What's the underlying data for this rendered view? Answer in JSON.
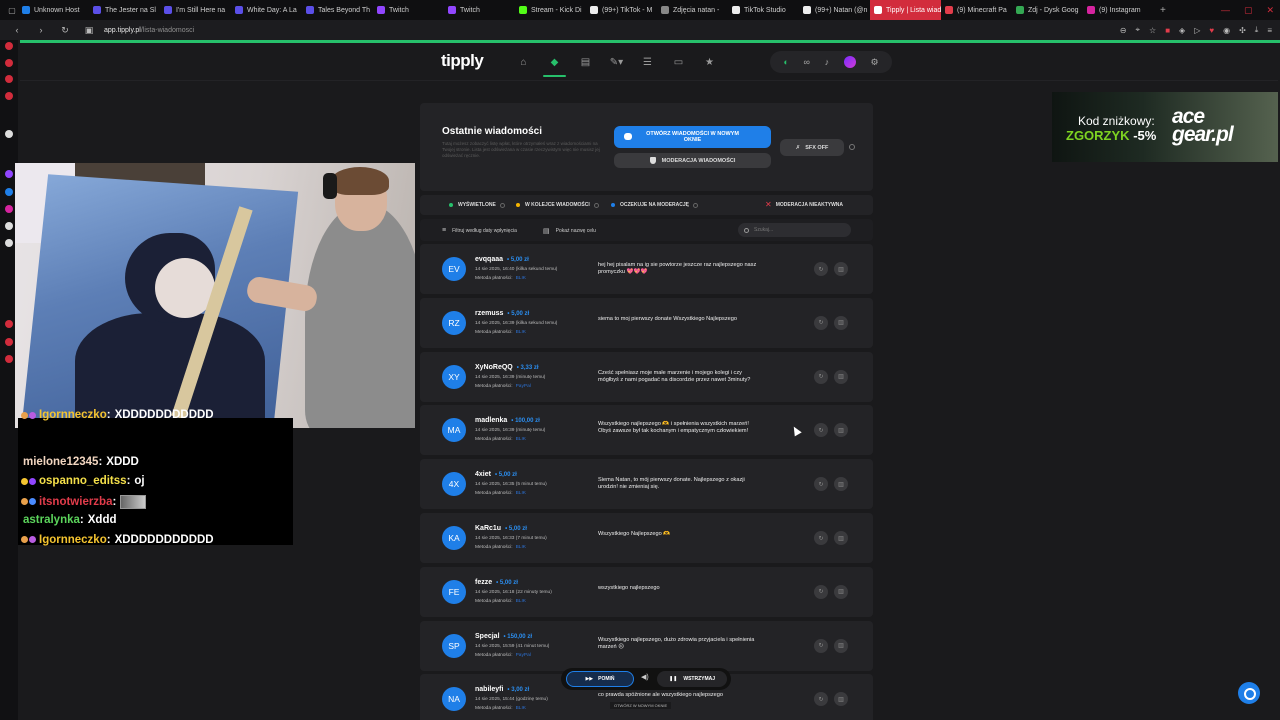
{
  "browser": {
    "tabs": [
      {
        "label": "Unknown Host",
        "color": "#1f7fe8",
        "active": false
      },
      {
        "label": "The Jester na Sl",
        "color": "#5b4fe8",
        "active": false
      },
      {
        "label": "I'm Still Here na",
        "color": "#5b4fe8",
        "active": false
      },
      {
        "label": "White Day: A La",
        "color": "#5b4fe8",
        "active": false
      },
      {
        "label": "Tales Beyond Th",
        "color": "#5b4fe8",
        "active": false
      },
      {
        "label": "Twitch",
        "color": "#9146ff",
        "active": false
      },
      {
        "label": "Twitch",
        "color": "#9146ff",
        "active": false
      },
      {
        "label": "Stream - Kick Di",
        "color": "#53fc18",
        "active": false
      },
      {
        "label": "(99+) TikTok - M",
        "color": "#eee",
        "active": false
      },
      {
        "label": "Zdjęcia natan -",
        "color": "#888",
        "active": false
      },
      {
        "label": "TikTok Studio",
        "color": "#eee",
        "active": false
      },
      {
        "label": "(99+) Natan (@n",
        "color": "#eee",
        "active": false
      },
      {
        "label": "Tipply | Lista wiadomości",
        "color": "#fff",
        "active": true
      },
      {
        "label": "(9) Minecraft Pa",
        "color": "#e23c4b",
        "active": false
      },
      {
        "label": "Zdj - Dysk Goog",
        "color": "#34a853",
        "active": false
      },
      {
        "label": "(9) Instagram",
        "color": "#d6249f",
        "active": false
      }
    ],
    "url_host": "app.tipply.pl",
    "url_path": "/lista-wiadomosci",
    "accent": "#27c06b"
  },
  "header": {
    "logo": "tipply"
  },
  "panel": {
    "title": "Ostatnie wiadomości",
    "description": "Tutaj możesz zobaczyć listę wpłat, które otrzymałeś wraz z wiadomościami na Twojej stronie. Lista jest odświeżana w czasie rzeczywistym więc nie musisz jej odświeżać ręcznie.",
    "open_button": "OTWÓRZ WIADOMOŚCI W NOWYM OKNIE",
    "mod_button": "MODERACJA WIADOMOŚCI",
    "sfx_button": "SFX OFF"
  },
  "status": {
    "displayed": "WYŚWIETLONE",
    "queue": "W KOLEJCE WIADOMOŚCI",
    "waiting": "OCZEKUJE NA MODERACJĘ",
    "moderation": "MODERACJA NIEAKTYWNA",
    "colors": {
      "displayed": "#27c06b",
      "queue": "#f5b400",
      "waiting": "#1f7fe8",
      "moderation": "#e23c4b"
    }
  },
  "filters": {
    "date_filter": "Filtruj według daty wpłynięcia",
    "show_page": "Pokaż nazwę celu",
    "search_placeholder": "Szukaj..."
  },
  "messages": [
    {
      "initials": "EV",
      "name": "evqqaaa",
      "amount": "5,00 zł",
      "date": "14 sie 2025, 16:40 (kilka sekund temu)",
      "pay_label": "Metoda płatności:",
      "method": "BLIK",
      "text": "hej hej pisalam na ig sie powtorze jeszcze raz najlepszego nasz promyczku 💖💖💖"
    },
    {
      "initials": "RZ",
      "name": "rzemuss",
      "amount": "5,00 zł",
      "date": "14 sie 2025, 16:39 (kilka sekund temu)",
      "pay_label": "Metoda płatności:",
      "method": "BLIK",
      "text": "siema to moj pierwszy donate Wszystkiego Najlepszego"
    },
    {
      "initials": "XY",
      "name": "XyNoReQQ",
      "amount": "3,33 zł",
      "date": "14 sie 2025, 16:39 (minutę temu)",
      "pay_label": "Metoda płatności:",
      "method": "PayPal",
      "text": "Cześć spełniasz moje małe marzenie i mojego kolegi i czy mógłbyś z nami pogadać na discordzie przez nawet 3minuty?"
    },
    {
      "initials": "MA",
      "name": "madlenka",
      "amount": "100,00 zł",
      "date": "14 sie 2025, 16:39 (minutę temu)",
      "pay_label": "Metoda płatności:",
      "method": "BLIK",
      "text": "Wszystkiego najlepszego 🫶 i spełnienia wszystkich marzeń! Obyś zawsze był tak kochanym i empatycznym człowiekiem!"
    },
    {
      "initials": "4X",
      "name": "4xiet",
      "amount": "5,00 zł",
      "date": "14 sie 2025, 16:35 (5 minut temu)",
      "pay_label": "Metoda płatności:",
      "method": "BLIK",
      "text": "Siema Natan, to mój pierwszy donate. Najlepszego z okazji urodzin! nie zmieniaj się."
    },
    {
      "initials": "KA",
      "name": "KaRc1u",
      "amount": "5,00 zł",
      "date": "14 sie 2025, 16:33 (7 minut temu)",
      "pay_label": "Metoda płatności:",
      "method": "BLIK",
      "text": "Wszystkiego Najlepszego 🫶"
    },
    {
      "initials": "FE",
      "name": "fezze",
      "amount": "5,00 zł",
      "date": "14 sie 2025, 16:18 (22 minuty temu)",
      "pay_label": "Metoda płatności:",
      "method": "BLIK",
      "text": "wszystkiego najlepszego"
    },
    {
      "initials": "SP",
      "name": "Specjal",
      "amount": "150,00 zł",
      "date": "14 sie 2025, 15:59 (41 minut temu)",
      "pay_label": "Metoda płatności:",
      "method": "PayPal",
      "text": "Wszystkiego najlepszego, dużo zdrowia przyjaciela i spełnienia marzeń 😐"
    },
    {
      "initials": "NA",
      "name": "nabileyfi",
      "amount": "3,00 zł",
      "date": "14 sie 2025, 15:44 (godzinę temu)",
      "pay_label": "Metoda płatności:",
      "method": "BLIK",
      "text": "co prawda spóźnione ale wszystkiego najlepszego"
    }
  ],
  "controls": {
    "skip": "POMIŃ",
    "pause": "WSTRZYMAJ",
    "open_window": "OTWÓRZ W NOWYM OKNIE"
  },
  "chat": [
    {
      "user": "Igornneczko",
      "message": "XDDDDDDDDDDD",
      "color": "#f4c430",
      "badges": [
        "#e8a04b",
        "#b85ce0"
      ]
    },
    {
      "user": "mielone12345",
      "message": "XDDD",
      "color": "#f2d6c0",
      "badges": []
    },
    {
      "user": "ospanno_editss",
      "message": "oj",
      "color": "#f5e04a",
      "badges": [
        "#f4c430",
        "#9146ff"
      ]
    },
    {
      "user": "itsnotwierzba",
      "message": "",
      "color": "#e23c4b",
      "badges": [
        "#e8a04b",
        "#4a8bff"
      ],
      "emote": true
    },
    {
      "user": "astralynka",
      "message": "Xddd",
      "color": "#5bd45b",
      "badges": []
    },
    {
      "user": "Igornneczko",
      "message": "XDDDDDDDDDDD",
      "color": "#f4c430",
      "badges": [
        "#e8a04b",
        "#b85ce0"
      ]
    }
  ],
  "promo": {
    "line1": "Kod zniżkowy:",
    "code": "ZGORZYK",
    "discount": "-5%",
    "brand_line1": "ace",
    "brand_line2": "gear.pl"
  }
}
